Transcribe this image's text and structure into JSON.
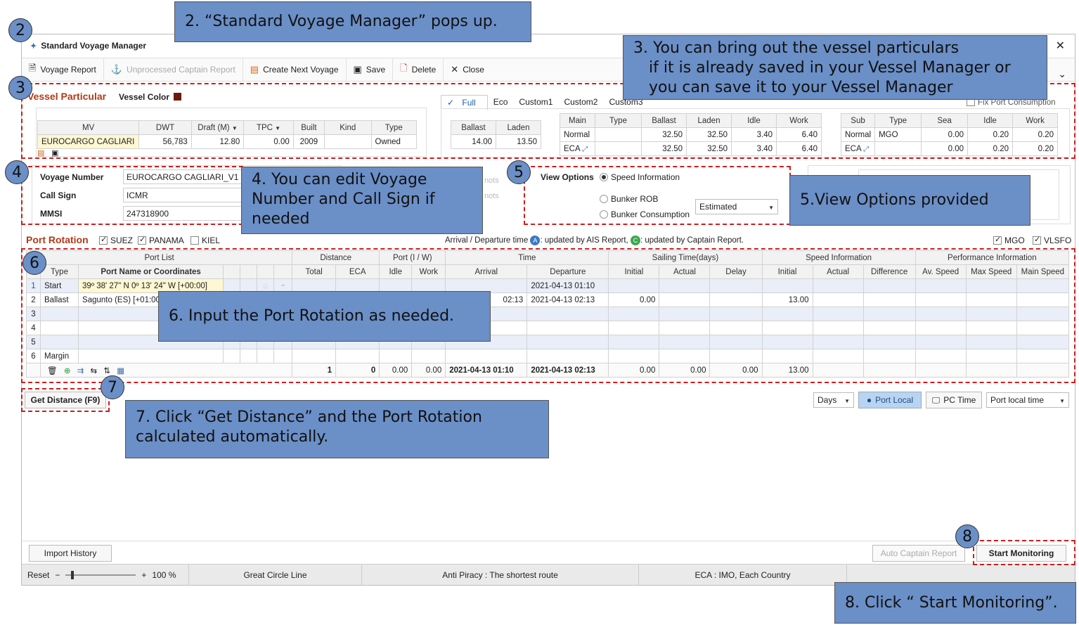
{
  "window": {
    "title": "Standard Voyage Manager",
    "close_symbol": "✕",
    "collapse_symbol": "⌄"
  },
  "toolbar": {
    "voyage_report": "Voyage Report",
    "unprocessed": "Unprocessed Captain Report",
    "create_next": "Create Next Voyage",
    "save": "Save",
    "delete": "Delete",
    "close": "Close"
  },
  "vessel": {
    "section_title": "Vessel Particular",
    "color_label": "Vessel Color",
    "color": "#6b1a0c",
    "headers": [
      "MV",
      "DWT",
      "Draft (M)",
      "TPC",
      "Built",
      "Kind",
      "Type"
    ],
    "row": [
      "EUROCARGO CAGLIARI",
      "56,783",
      "12.80",
      "0.00",
      "2009",
      "",
      "Owned"
    ],
    "speed_tabs": [
      "Full",
      "Eco",
      "Custom1",
      "Custom2",
      "Custom3"
    ],
    "fix_port": "Fix Port Consumption",
    "ballast_laden_headers": [
      "Ballast",
      "Laden"
    ],
    "ballast_laden_values": [
      "14.00",
      "13.50"
    ],
    "main_headers": [
      "Main",
      "Type",
      "Ballast",
      "Laden",
      "Idle",
      "Work"
    ],
    "main_rows": [
      [
        "Normal",
        "",
        "32.50",
        "32.50",
        "3.40",
        "6.40"
      ],
      [
        "ECA",
        "",
        "32.50",
        "32.50",
        "3.40",
        "6.40"
      ]
    ],
    "sub_headers": [
      "Sub",
      "Type",
      "Sea",
      "Idle",
      "Work"
    ],
    "sub_rows": [
      [
        "Normal",
        "MGO",
        "0.00",
        "0.20",
        "0.20"
      ],
      [
        "ECA",
        "",
        "0.00",
        "0.20",
        "0.20"
      ]
    ]
  },
  "voyage": {
    "number_label": "Voyage Number",
    "number_value": "EUROCARGO CAGLIARI_V1",
    "callsign_label": "Call Sign",
    "callsign_value": "ICMR",
    "mmsi_label": "MMSI",
    "mmsi_value": "247318900",
    "knots_1": "nots",
    "knots_2": "nots"
  },
  "view_options": {
    "label": "View Options",
    "speed_info": "Speed Information",
    "bunker_rob": "Bunker ROB",
    "bunker_cons": "Bunker Consumption",
    "estimated": "Estimated"
  },
  "port_rotation": {
    "title": "Port Rotation",
    "suez": "SUEZ",
    "panama": "PANAMA",
    "kiel": "KIEL",
    "legend_pre": "Arrival / Departure time",
    "legend_a": "A",
    "legend_ais": ": updated by AIS Report,",
    "legend_c": "C",
    "legend_captain": ": updated by Captain Report.",
    "mgo": "MGO",
    "vlsfo": "VLSFO",
    "groups": [
      "Port List",
      "Distance",
      "Port (I / W)",
      "Time",
      "Sailing Time(days)",
      "Speed Information",
      "Performance Information"
    ],
    "cols": [
      "Type",
      "Port Name or Coordinates",
      "Total",
      "ECA",
      "Idle",
      "Work",
      "Arrival",
      "Departure",
      "Initial",
      "Actual",
      "Delay",
      "Initial",
      "Actual",
      "Difference",
      "Av. Speed",
      "Max Speed",
      "Main Speed"
    ],
    "rows": [
      {
        "n": "1",
        "type": "Start",
        "port": "39º 38' 27\" N 0º 13' 24\" W [+00:00]",
        "arrival": "",
        "departure": "2021-04-13 01:10",
        "sail_init": "",
        "spd_init": ""
      },
      {
        "n": "2",
        "type": "Ballast",
        "port": "Sagunto (ES) [+01:00]",
        "arrival": "02:13",
        "departure": "2021-04-13 02:13",
        "sail_init": "0.00",
        "spd_init": "13.00"
      },
      {
        "n": "3",
        "type": "",
        "port": "",
        "arrival": "",
        "departure": "",
        "sail_init": "",
        "spd_init": ""
      },
      {
        "n": "4",
        "type": "",
        "port": "",
        "arrival": "",
        "departure": "",
        "sail_init": "",
        "spd_init": ""
      },
      {
        "n": "5",
        "type": "",
        "port": "",
        "arrival": "",
        "departure": "",
        "sail_init": "",
        "spd_init": ""
      },
      {
        "n": "6",
        "type": "Margin",
        "port": "",
        "arrival": "",
        "departure": "",
        "sail_init": "",
        "spd_init": ""
      }
    ],
    "totals": {
      "total": "1",
      "eca": "0",
      "idle": "0.00",
      "work": "0.00",
      "arrival": "2021-04-13 01:10",
      "departure": "2021-04-13 02:13",
      "s_init": "0.00",
      "s_act": "0.00",
      "s_delay": "0.00",
      "sp_init": "13.00"
    }
  },
  "bottom": {
    "get_distance": "Get Distance (F9)",
    "days": "Days",
    "port_local": "Port Local",
    "pc_time": "PC Time",
    "port_local_time": "Port local time",
    "import_history": "Import History",
    "auto_captain": "Auto Captain Report",
    "start_monitoring": "Start Monitoring"
  },
  "status": {
    "reset": "Reset",
    "zoom": "100 %",
    "great_circle": "Great Circle Line",
    "anti_piracy": "Anti Piracy : The shortest route",
    "eca": "ECA : IMO, Each Country"
  },
  "callouts": {
    "c2": "2. “Standard Voyage Manager” pops up.",
    "c3_l1": "3. You can bring out the vessel particulars",
    "c3_l2": "if it is already saved in your Vessel Manager or",
    "c3_l3": "you can save it to your Vessel Manager",
    "c4_l1": "4. You can edit Voyage",
    "c4_l2": "Number and Call Sign if",
    "c4_l3": "needed",
    "c5": "5.View Options provided",
    "c6": "6. Input the Port Rotation as needed.",
    "c7_l1": "7. Click “Get Distance” and the Port Rotation",
    "c7_l2": "calculated automatically.",
    "c8": "8. Click “ Start Monitoring”.",
    "n2": "2",
    "n3": "3",
    "n4": "4",
    "n5": "5",
    "n6": "6",
    "n7": "7",
    "n8": "8"
  }
}
